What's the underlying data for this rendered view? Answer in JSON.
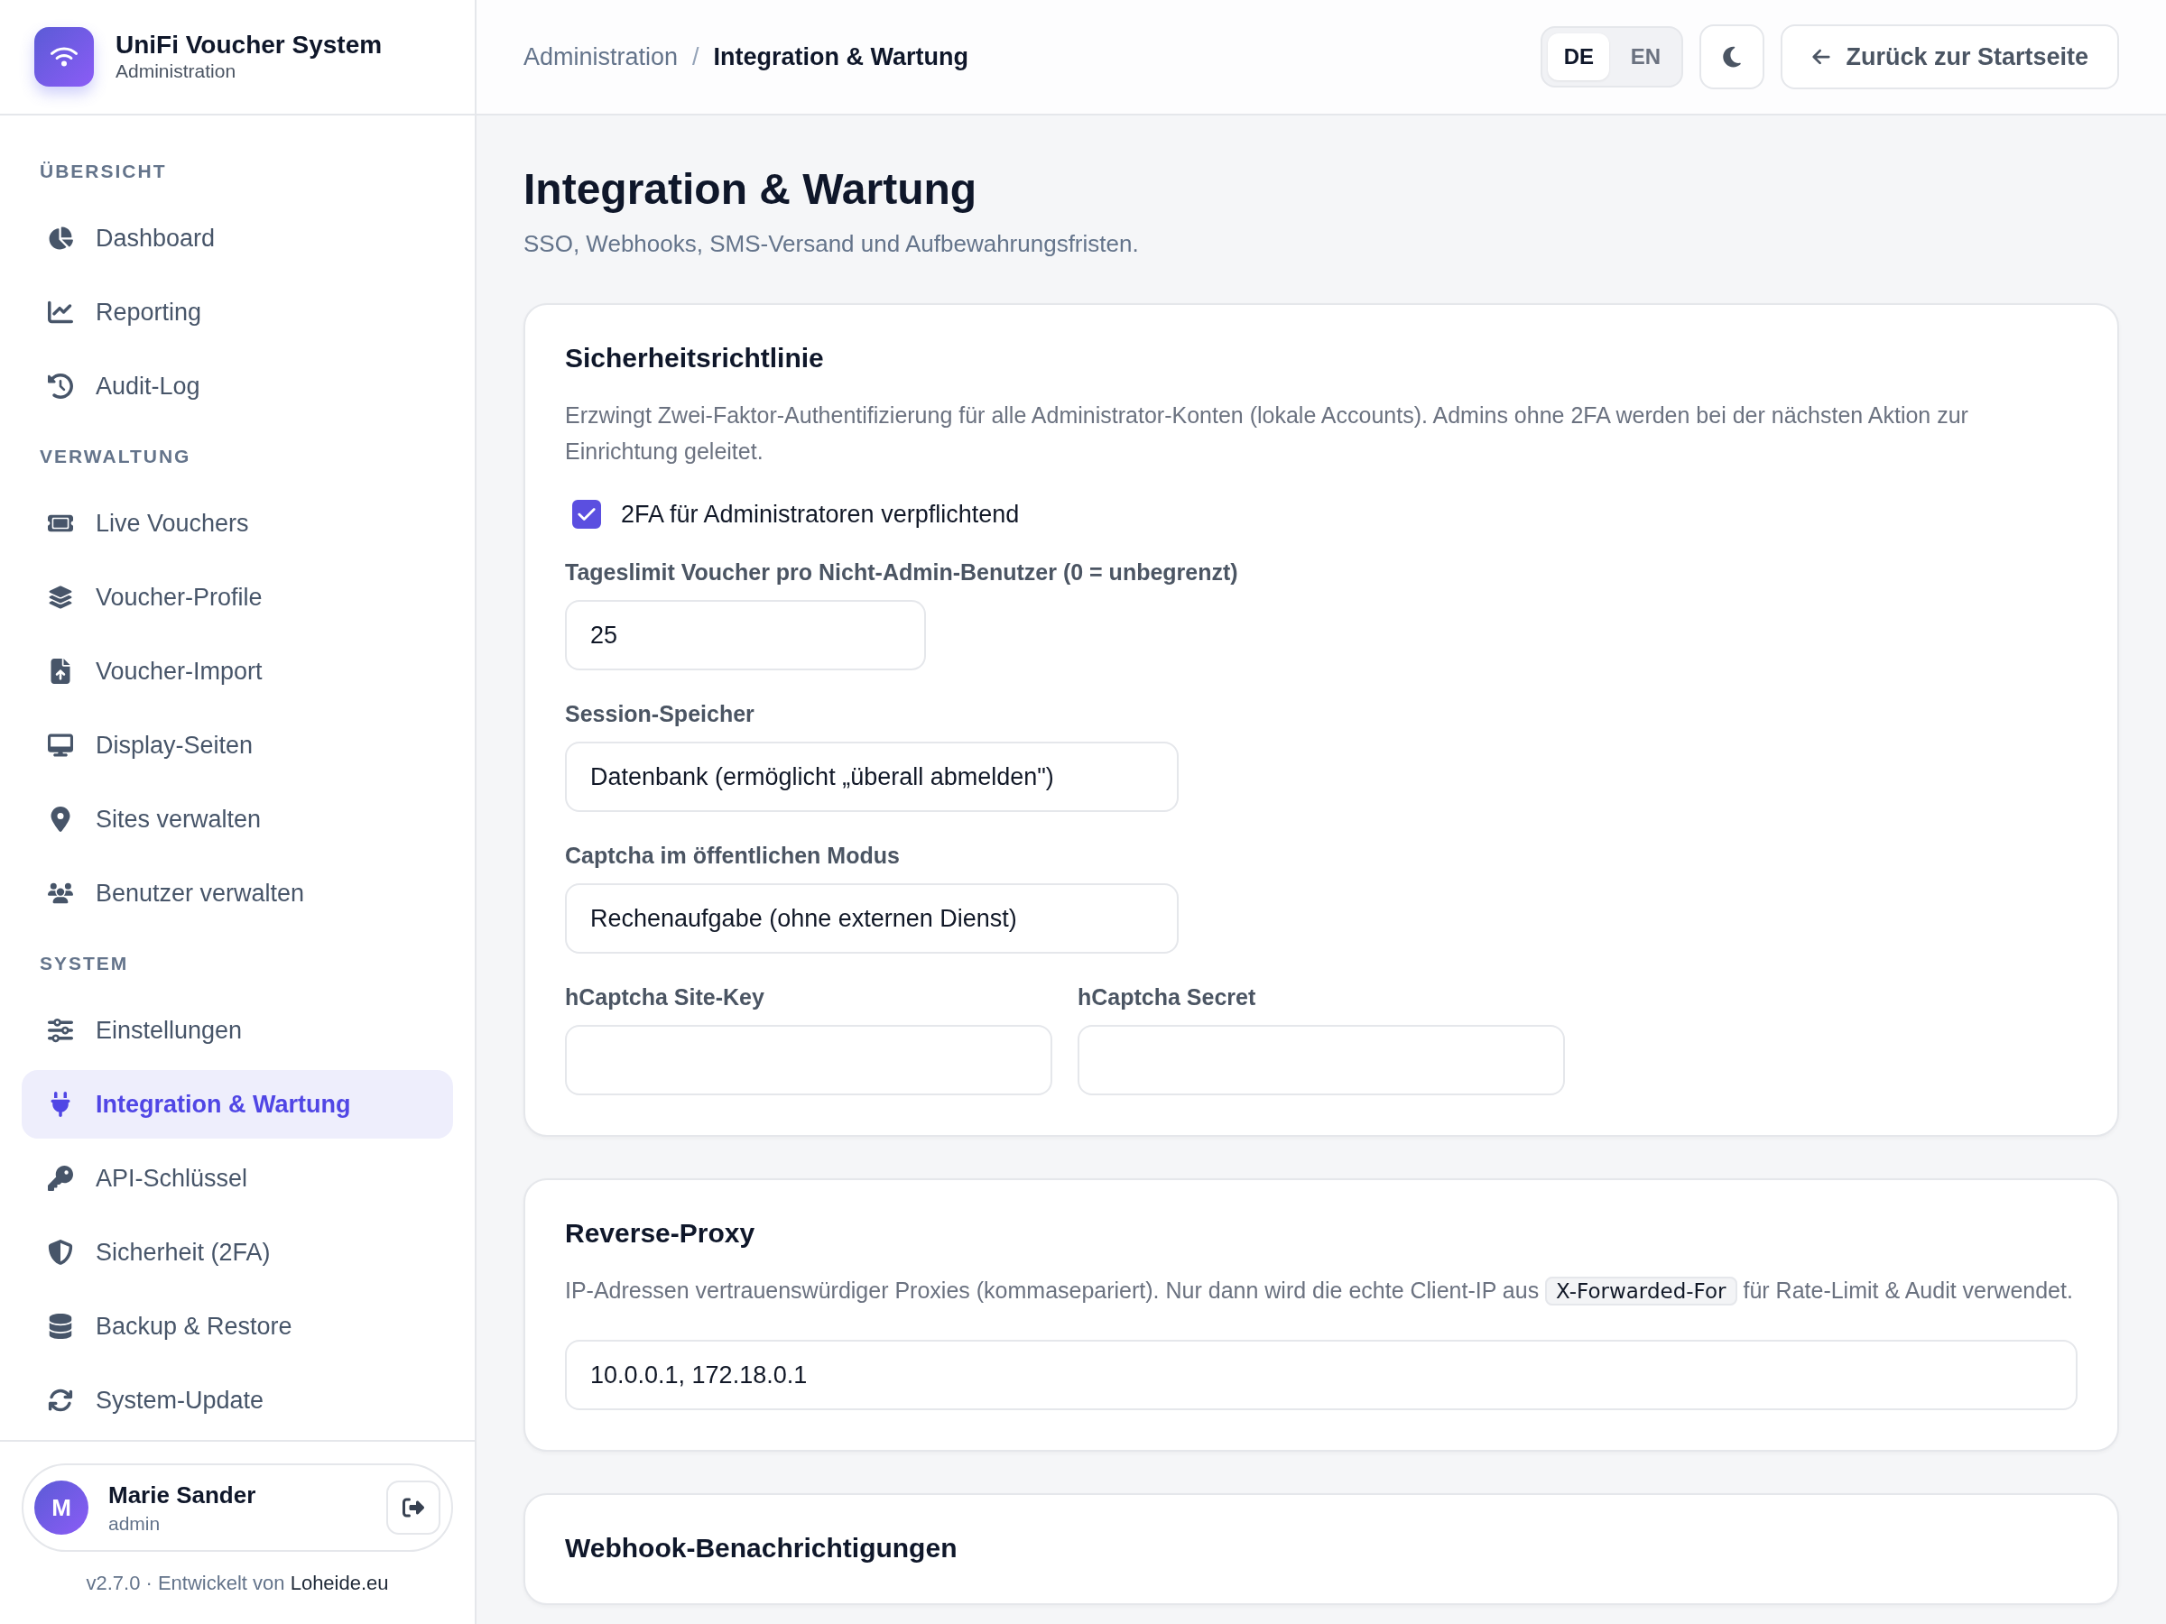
{
  "brand": {
    "title": "UniFi Voucher System",
    "subtitle": "Administration"
  },
  "sidebar": {
    "sections": [
      {
        "title": "ÜBERSICHT",
        "items": [
          {
            "label": "Dashboard",
            "selected": false
          },
          {
            "label": "Reporting",
            "selected": false
          },
          {
            "label": "Audit-Log",
            "selected": false
          }
        ]
      },
      {
        "title": "VERWALTUNG",
        "items": [
          {
            "label": "Live Vouchers",
            "selected": false
          },
          {
            "label": "Voucher-Profile",
            "selected": false
          },
          {
            "label": "Voucher-Import",
            "selected": false
          },
          {
            "label": "Display-Seiten",
            "selected": false
          },
          {
            "label": "Sites verwalten",
            "selected": false
          },
          {
            "label": "Benutzer verwalten",
            "selected": false
          }
        ]
      },
      {
        "title": "SYSTEM",
        "items": [
          {
            "label": "Einstellungen",
            "selected": false
          },
          {
            "label": "Integration & Wartung",
            "selected": true
          },
          {
            "label": "API-Schlüssel",
            "selected": false
          },
          {
            "label": "Sicherheit (2FA)",
            "selected": false
          },
          {
            "label": "Backup & Restore",
            "selected": false
          },
          {
            "label": "System-Update",
            "selected": false
          }
        ]
      }
    ],
    "user": {
      "initial": "M",
      "name": "Marie Sander",
      "role": "admin"
    },
    "footer": {
      "text": "v2.7.0 · Entwickelt von ",
      "link": "Loheide.eu"
    }
  },
  "header": {
    "breadcrumb_separator": "/",
    "breadcrumb": [
      {
        "label": "Administration",
        "current": false
      },
      {
        "label": "Integration & Wartung",
        "current": true
      }
    ],
    "languages": [
      {
        "label": "DE",
        "selected": true
      },
      {
        "label": "EN",
        "selected": false
      }
    ],
    "back_button": "Zurück zur Startseite"
  },
  "page": {
    "title": "Integration & Wartung",
    "subtitle": "SSO, Webhooks, SMS-Versand und Aufbewahrungsfristen."
  },
  "cards": [
    {
      "title": "Sicherheitsrichtlinie",
      "description": {
        "before": "Erzwingt Zwei-Faktor-Authentifizierung für alle Administrator-Konten (lokale Accounts). Admins ohne 2FA werden bei der nächsten Aktion zur Einrichtung geleitet."
      },
      "checkbox": {
        "label": "2FA für Administratoren verpflichtend",
        "checked": true
      },
      "rows": [
        [
          {
            "kind": "number",
            "label": "Tageslimit Voucher pro Nicht-Admin-Benutzer (0 = unbegrenzt)",
            "value": "25"
          }
        ],
        [
          {
            "kind": "select",
            "label": "Session-Speicher",
            "value": "Datenbank (ermöglicht „überall abmelden\")"
          }
        ],
        [
          {
            "kind": "select",
            "label": "Captcha im öffentlichen Modus",
            "value": "Rechenaufgabe (ohne externen Dienst)"
          }
        ],
        [
          {
            "kind": "text",
            "label": "hCaptcha Site-Key"
          },
          {
            "kind": "text",
            "label": "hCaptcha Secret"
          }
        ]
      ]
    },
    {
      "title": "Reverse-Proxy",
      "description": {
        "before": "IP-Adressen vertrauenswürdiger Proxies (kommasepariert). Nur dann wird die echte Client-IP aus ",
        "code": "X-Forwarded-For",
        "after": " für Rate-Limit & Audit verwendet."
      },
      "rows": [
        [
          {
            "kind": "text",
            "value": "10.0.0.1, 172.18.0.1"
          }
        ]
      ]
    },
    {
      "title": "Webhook-Benachrichtigungen"
    }
  ]
}
